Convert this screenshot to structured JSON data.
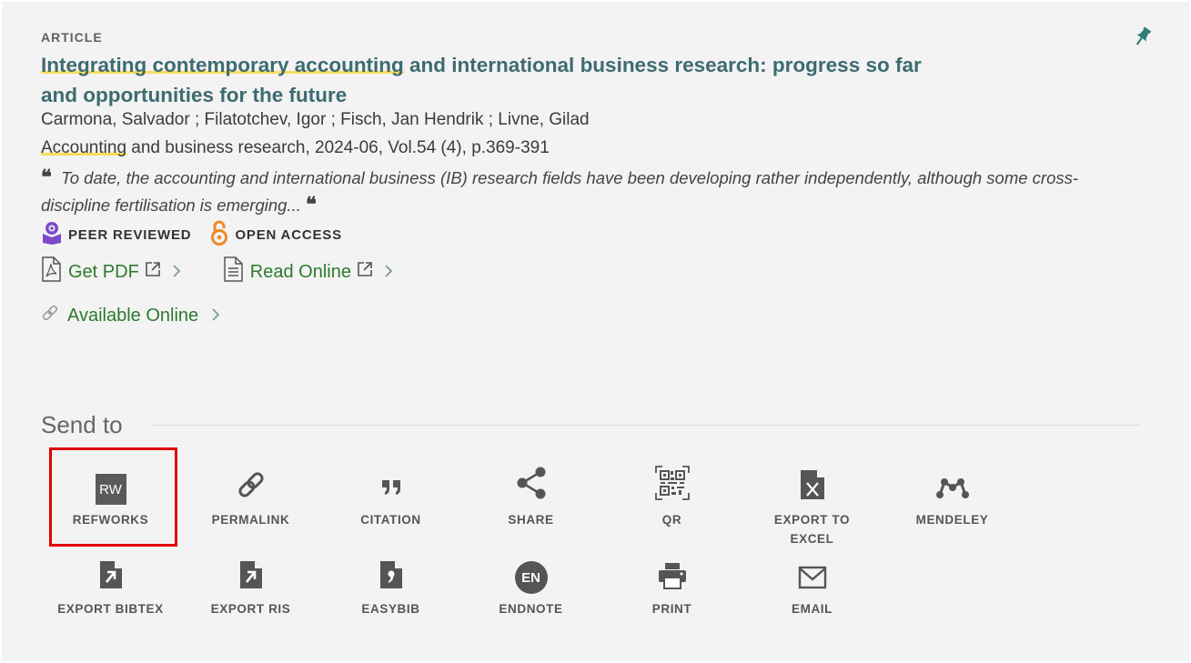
{
  "record": {
    "type_label": "ARTICLE",
    "title_part1": "Integrating contemporary accounting",
    "title_part2": " and international business research: progress so far and opportunities for the future",
    "authors": "Carmona, Salvador ; Filatotchev, Igor ; Fisch, Jan Hendrik ; Livne, Gilad",
    "source_highlight": "Accounting",
    "source_rest": " and business research, 2024-06, Vol.54 (4), p.369-391",
    "abstract": "To date, the accounting and international business (IB) research fields have been developing rather independently, although some cross-discipline fertilisation is emerging..."
  },
  "badges": {
    "peer_reviewed": "PEER REVIEWED",
    "open_access": "OPEN ACCESS"
  },
  "links": {
    "get_pdf": "Get PDF",
    "read_online": "Read Online",
    "available_online": "Available Online"
  },
  "send_to": {
    "title": "Send to",
    "actions": [
      {
        "label": "REFWORKS",
        "icon": "refworks-icon"
      },
      {
        "label": "PERMALINK",
        "icon": "link-icon"
      },
      {
        "label": "CITATION",
        "icon": "quote-icon"
      },
      {
        "label": "SHARE",
        "icon": "share-icon"
      },
      {
        "label": "QR",
        "icon": "qr-icon"
      },
      {
        "label": "EXPORT TO EXCEL",
        "icon": "excel-icon"
      },
      {
        "label": "MENDELEY",
        "icon": "mendeley-icon"
      },
      {
        "label": "EXPORT BIBTEX",
        "icon": "export-file-icon"
      },
      {
        "label": "EXPORT RIS",
        "icon": "export-file-icon"
      },
      {
        "label": "EASYBIB",
        "icon": "easybib-icon"
      },
      {
        "label": "ENDNOTE",
        "icon": "endnote-icon"
      },
      {
        "label": "PRINT",
        "icon": "printer-icon"
      },
      {
        "label": "EMAIL",
        "icon": "envelope-icon"
      }
    ],
    "refworks_badge": "RW",
    "endnote_badge": "EN"
  },
  "colors": {
    "title": "#3d6b70",
    "link": "#2d7a2d",
    "highlight": "#f7dd5a",
    "selection_box": "#e00000",
    "peer_reviewed_icon": "#7b4bc9",
    "open_access_icon": "#f0892a",
    "pin": "#2e7d7a"
  }
}
